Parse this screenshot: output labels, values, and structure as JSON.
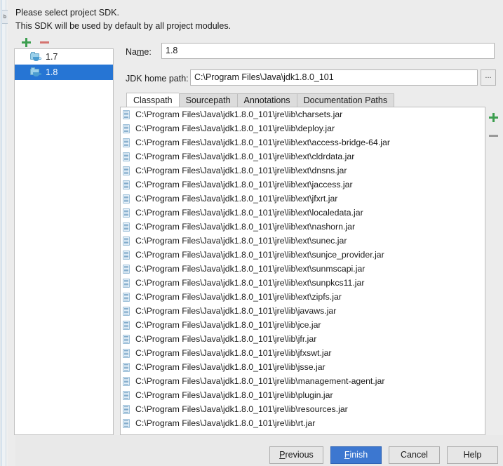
{
  "dialog": {
    "intro_line1": "Please select project SDK.",
    "intro_line2": "This SDK will be used by default by all project modules."
  },
  "sdk_tree": {
    "toolbar": {
      "add_label": "+",
      "remove_label": "−",
      "add_icon": "plus-icon",
      "remove_icon": "minus-icon"
    },
    "items": [
      {
        "label": "1.7",
        "icon": "jdk-folder-icon",
        "selected": false
      },
      {
        "label": "1.8",
        "icon": "jdk-folder-icon",
        "selected": true
      }
    ]
  },
  "form": {
    "name_label_pre": "Na",
    "name_label_mn": "m",
    "name_label_post": "e:",
    "name_label": "Name:",
    "name_value": "1.8",
    "home_label": "JDK home path:",
    "home_value": "C:\\Program Files\\Java\\jdk1.8.0_101",
    "browse_label": "..."
  },
  "tabs": [
    {
      "label": "Classpath",
      "active": true
    },
    {
      "label": "Sourcepath",
      "active": false
    },
    {
      "label": "Annotations",
      "active": false
    },
    {
      "label": "Documentation Paths",
      "active": false
    }
  ],
  "classpath": {
    "side_toolbar": {
      "add_icon": "plus-icon",
      "remove_icon": "minus-icon"
    },
    "entries": [
      "C:\\Program Files\\Java\\jdk1.8.0_101\\jre\\lib\\charsets.jar",
      "C:\\Program Files\\Java\\jdk1.8.0_101\\jre\\lib\\deploy.jar",
      "C:\\Program Files\\Java\\jdk1.8.0_101\\jre\\lib\\ext\\access-bridge-64.jar",
      "C:\\Program Files\\Java\\jdk1.8.0_101\\jre\\lib\\ext\\cldrdata.jar",
      "C:\\Program Files\\Java\\jdk1.8.0_101\\jre\\lib\\ext\\dnsns.jar",
      "C:\\Program Files\\Java\\jdk1.8.0_101\\jre\\lib\\ext\\jaccess.jar",
      "C:\\Program Files\\Java\\jdk1.8.0_101\\jre\\lib\\ext\\jfxrt.jar",
      "C:\\Program Files\\Java\\jdk1.8.0_101\\jre\\lib\\ext\\localedata.jar",
      "C:\\Program Files\\Java\\jdk1.8.0_101\\jre\\lib\\ext\\nashorn.jar",
      "C:\\Program Files\\Java\\jdk1.8.0_101\\jre\\lib\\ext\\sunec.jar",
      "C:\\Program Files\\Java\\jdk1.8.0_101\\jre\\lib\\ext\\sunjce_provider.jar",
      "C:\\Program Files\\Java\\jdk1.8.0_101\\jre\\lib\\ext\\sunmscapi.jar",
      "C:\\Program Files\\Java\\jdk1.8.0_101\\jre\\lib\\ext\\sunpkcs11.jar",
      "C:\\Program Files\\Java\\jdk1.8.0_101\\jre\\lib\\ext\\zipfs.jar",
      "C:\\Program Files\\Java\\jdk1.8.0_101\\jre\\lib\\javaws.jar",
      "C:\\Program Files\\Java\\jdk1.8.0_101\\jre\\lib\\jce.jar",
      "C:\\Program Files\\Java\\jdk1.8.0_101\\jre\\lib\\jfr.jar",
      "C:\\Program Files\\Java\\jdk1.8.0_101\\jre\\lib\\jfxswt.jar",
      "C:\\Program Files\\Java\\jdk1.8.0_101\\jre\\lib\\jsse.jar",
      "C:\\Program Files\\Java\\jdk1.8.0_101\\jre\\lib\\management-agent.jar",
      "C:\\Program Files\\Java\\jdk1.8.0_101\\jre\\lib\\plugin.jar",
      "C:\\Program Files\\Java\\jdk1.8.0_101\\jre\\lib\\resources.jar",
      "C:\\Program Files\\Java\\jdk1.8.0_101\\jre\\lib\\rt.jar"
    ]
  },
  "buttons": {
    "previous": {
      "label": "Previous",
      "mnemonic": "P"
    },
    "finish": {
      "label": "Finish",
      "mnemonic": "F"
    },
    "cancel": {
      "label": "Cancel"
    },
    "help": {
      "label": "Help"
    }
  },
  "background_window": {
    "tab_label": "b"
  },
  "colors": {
    "accent": "#2675d4",
    "primary_button": "#3c77d0",
    "add_icon": "#3c9e4f",
    "remove_icon": "#d4736f",
    "dialog_bg": "#ececec"
  }
}
